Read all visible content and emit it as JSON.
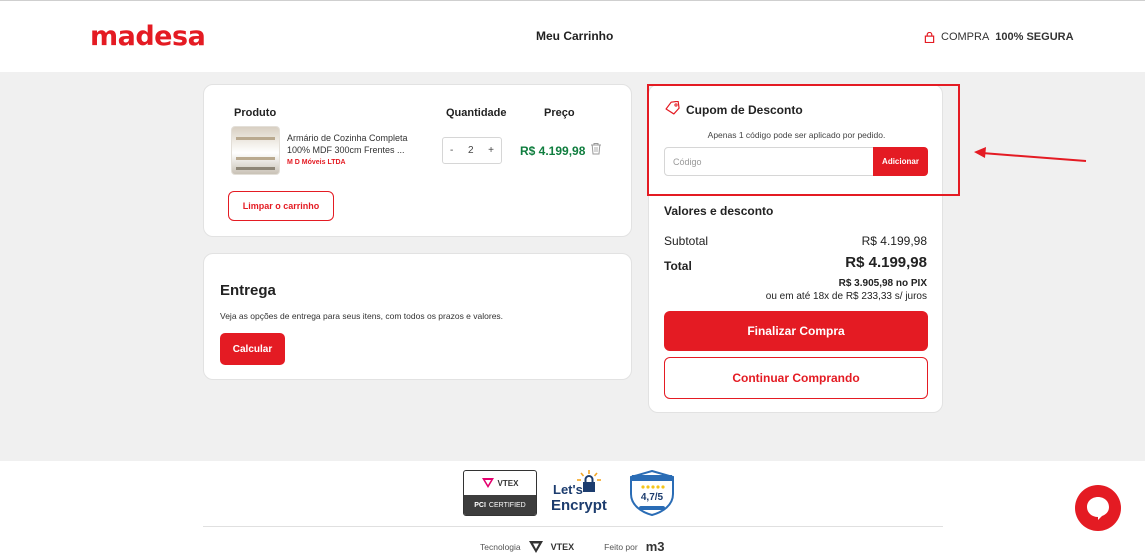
{
  "header": {
    "logo": "madesa",
    "title": "Meu Carrinho",
    "secure_prefix": "COMPRA",
    "secure_bold": "100% SEGURA"
  },
  "cart": {
    "columns": {
      "product": "Produto",
      "quantity": "Quantidade",
      "price": "Preço"
    },
    "item": {
      "name": "Armário de Cozinha Completa 100% MDF 300cm Frentes ...",
      "seller": "M D Móveis LTDA",
      "quantity": "2",
      "minus": "-",
      "plus": "+",
      "price": "R$ 4.199,98"
    },
    "clear_label": "Limpar o carrinho"
  },
  "delivery": {
    "title": "Entrega",
    "text": "Veja as opções de entrega para seus itens, com todos os prazos e valores.",
    "button_label": "Calcular"
  },
  "coupon": {
    "title": "Cupom de Desconto",
    "note": "Apenas 1 código pode ser aplicado por pedido.",
    "placeholder": "Código",
    "button_label": "Adicionar"
  },
  "summary": {
    "title": "Valores e desconto",
    "subtotal_label": "Subtotal",
    "subtotal_value": "R$ 4.199,98",
    "total_label": "Total",
    "total_value": "R$ 4.199,98",
    "pix_line": "R$ 3.905,98 no PIX",
    "installments_line": "ou em até 18x de R$ 233,33 s/ juros",
    "finish_label": "Finalizar Compra",
    "continue_label": "Continuar Comprando"
  },
  "footer": {
    "seal_vtex_top": "VTEX",
    "seal_vtex_bottom": "CERTIFIED",
    "seal_vtex_pci": "PCI",
    "seal_le_lets": "Let's",
    "seal_le_encrypt": "Encrypt",
    "seal_rating": "4,7/5",
    "tech_label": "Tecnologia",
    "tech_brand": "VTEX",
    "made_by_label": "Feito por",
    "made_by_brand": "m3"
  },
  "colors": {
    "brand_red": "#e41b23",
    "price_green": "#0f7d3e"
  }
}
